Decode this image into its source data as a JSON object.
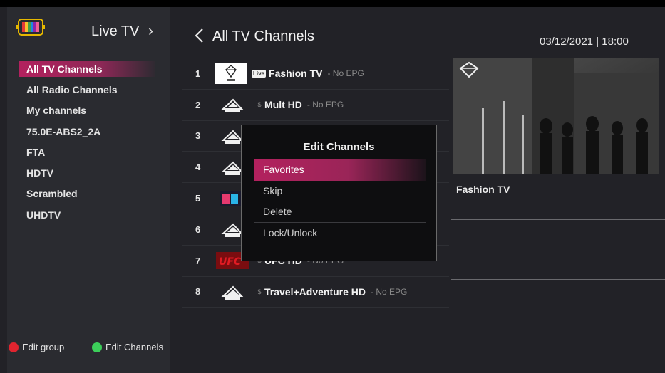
{
  "app": {
    "title": "Live TV",
    "logo_icon": "tv-icon",
    "arrow_icon": "chevron-right-icon"
  },
  "sidebar": {
    "groups": [
      {
        "label": "All TV Channels",
        "active": true
      },
      {
        "label": "All Radio Channels",
        "active": false
      },
      {
        "label": "My channels",
        "active": false
      },
      {
        "label": "75.0E-ABS2_2A",
        "active": false
      },
      {
        "label": "FTA",
        "active": false
      },
      {
        "label": "HDTV",
        "active": false
      },
      {
        "label": "Scrambled",
        "active": false
      },
      {
        "label": "UHDTV",
        "active": false
      }
    ],
    "legend": {
      "edit_group": {
        "label": "Edit group",
        "color": "#e0242f"
      },
      "edit_channels": {
        "label": "Edit Channels",
        "color": "#3ccf5a"
      }
    }
  },
  "header": {
    "title": "All TV Channels",
    "datetime": "03/12/2021 | 18:00"
  },
  "channels": [
    {
      "num": "1",
      "name": "Fashion TV",
      "epg": "- No EPG",
      "live": "Live",
      "logo": "ftv-logo"
    },
    {
      "num": "2",
      "name": "Mult HD",
      "epg": "- No EPG",
      "logo": "no-logo"
    },
    {
      "num": "3",
      "name": "",
      "epg": "",
      "logo": "no-logo"
    },
    {
      "num": "4",
      "name": "",
      "epg": "",
      "logo": "no-logo"
    },
    {
      "num": "5",
      "name": "",
      "epg": "",
      "logo": "fav-logo"
    },
    {
      "num": "6",
      "name": "",
      "epg": "",
      "logo": "no-logo"
    },
    {
      "num": "7",
      "name": "UFC HD",
      "epg": "- No EPG",
      "logo": "ufc-logo"
    },
    {
      "num": "8",
      "name": "Travel+Adventure HD",
      "epg": "- No EPG",
      "logo": "no-logo"
    }
  ],
  "preview": {
    "channel_name": "Fashion TV"
  },
  "dialog": {
    "title": "Edit Channels",
    "options": [
      {
        "label": "Favorites",
        "active": true
      },
      {
        "label": "Skip",
        "active": false
      },
      {
        "label": "Delete",
        "active": false
      },
      {
        "label": "Lock/Unlock",
        "active": false
      }
    ]
  },
  "colors": {
    "accent": "#b3215e",
    "sidebar_bg": "#2a2b30",
    "main_bg": "#222227"
  }
}
